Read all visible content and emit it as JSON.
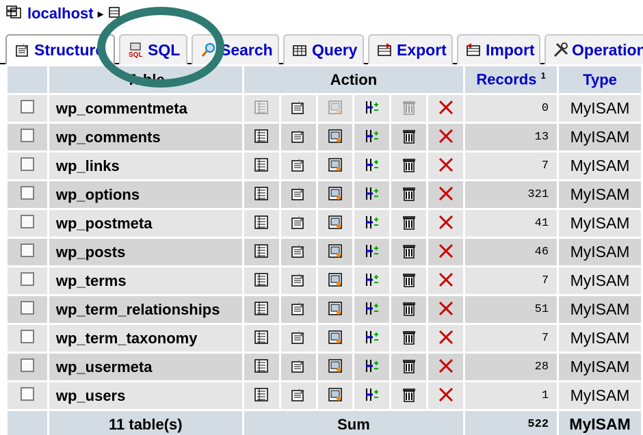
{
  "breadcrumb": {
    "server": "localhost"
  },
  "tabs": [
    {
      "label": "Structure",
      "icon": "structure-icon",
      "active": true
    },
    {
      "label": "SQL",
      "icon": "sql-icon"
    },
    {
      "label": "Search",
      "icon": "search-icon"
    },
    {
      "label": "Query",
      "icon": "query-icon"
    },
    {
      "label": "Export",
      "icon": "export-icon"
    },
    {
      "label": "Import",
      "icon": "import-icon"
    },
    {
      "label": "Operations",
      "icon": "operations-icon"
    }
  ],
  "table": {
    "headers": {
      "table": "Table",
      "action": "Action",
      "records": "Records",
      "records_note": "1",
      "type": "Type"
    },
    "rows": [
      {
        "name": "wp_commentmeta",
        "records": "0",
        "type": "MyISAM"
      },
      {
        "name": "wp_comments",
        "records": "13",
        "type": "MyISAM"
      },
      {
        "name": "wp_links",
        "records": "7",
        "type": "MyISAM"
      },
      {
        "name": "wp_options",
        "records": "321",
        "type": "MyISAM"
      },
      {
        "name": "wp_postmeta",
        "records": "41",
        "type": "MyISAM"
      },
      {
        "name": "wp_posts",
        "records": "46",
        "type": "MyISAM"
      },
      {
        "name": "wp_terms",
        "records": "7",
        "type": "MyISAM"
      },
      {
        "name": "wp_term_relationships",
        "records": "51",
        "type": "MyISAM"
      },
      {
        "name": "wp_term_taxonomy",
        "records": "7",
        "type": "MyISAM"
      },
      {
        "name": "wp_usermeta",
        "records": "28",
        "type": "MyISAM"
      },
      {
        "name": "wp_users",
        "records": "1",
        "type": "MyISAM"
      }
    ],
    "footer": {
      "count": "11 table(s)",
      "sum_label": "Sum",
      "records_total": "522",
      "type": "MyISAM"
    }
  },
  "action_icons": [
    "browse-icon",
    "structure-icon",
    "search-icon",
    "insert-icon",
    "empty-icon",
    "drop-icon"
  ],
  "annotation": {
    "color": "#2f7a72",
    "shape": "circle"
  },
  "colors": {
    "link": "#0000cc",
    "header_bg": "#d3dce3",
    "row_odd": "#e5e5e5",
    "row_even": "#d5d5d5",
    "drop": "#cc0000"
  }
}
